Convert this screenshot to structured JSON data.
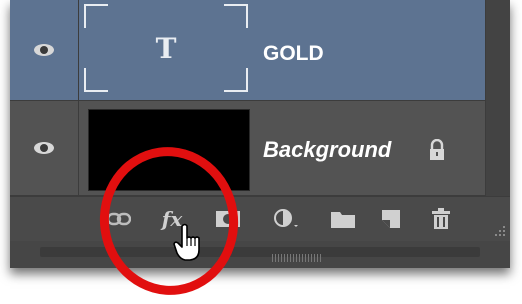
{
  "layers": [
    {
      "name": "GOLD",
      "type": "text",
      "thumbnail_glyph": "T",
      "selected": true,
      "visible": true
    },
    {
      "name": "Background",
      "type": "background",
      "locked": true,
      "visible": true
    }
  ],
  "toolbar": {
    "buttons": [
      "link-layers-icon",
      "fx-icon",
      "add-mask-icon",
      "adjustment-layer-icon",
      "new-group-icon",
      "new-layer-icon",
      "delete-layer-icon"
    ],
    "fx_label": "fx"
  },
  "colors": {
    "panel": "#535353",
    "selected_layer": "#5d7391",
    "highlight_circle": "#e10f0f"
  }
}
